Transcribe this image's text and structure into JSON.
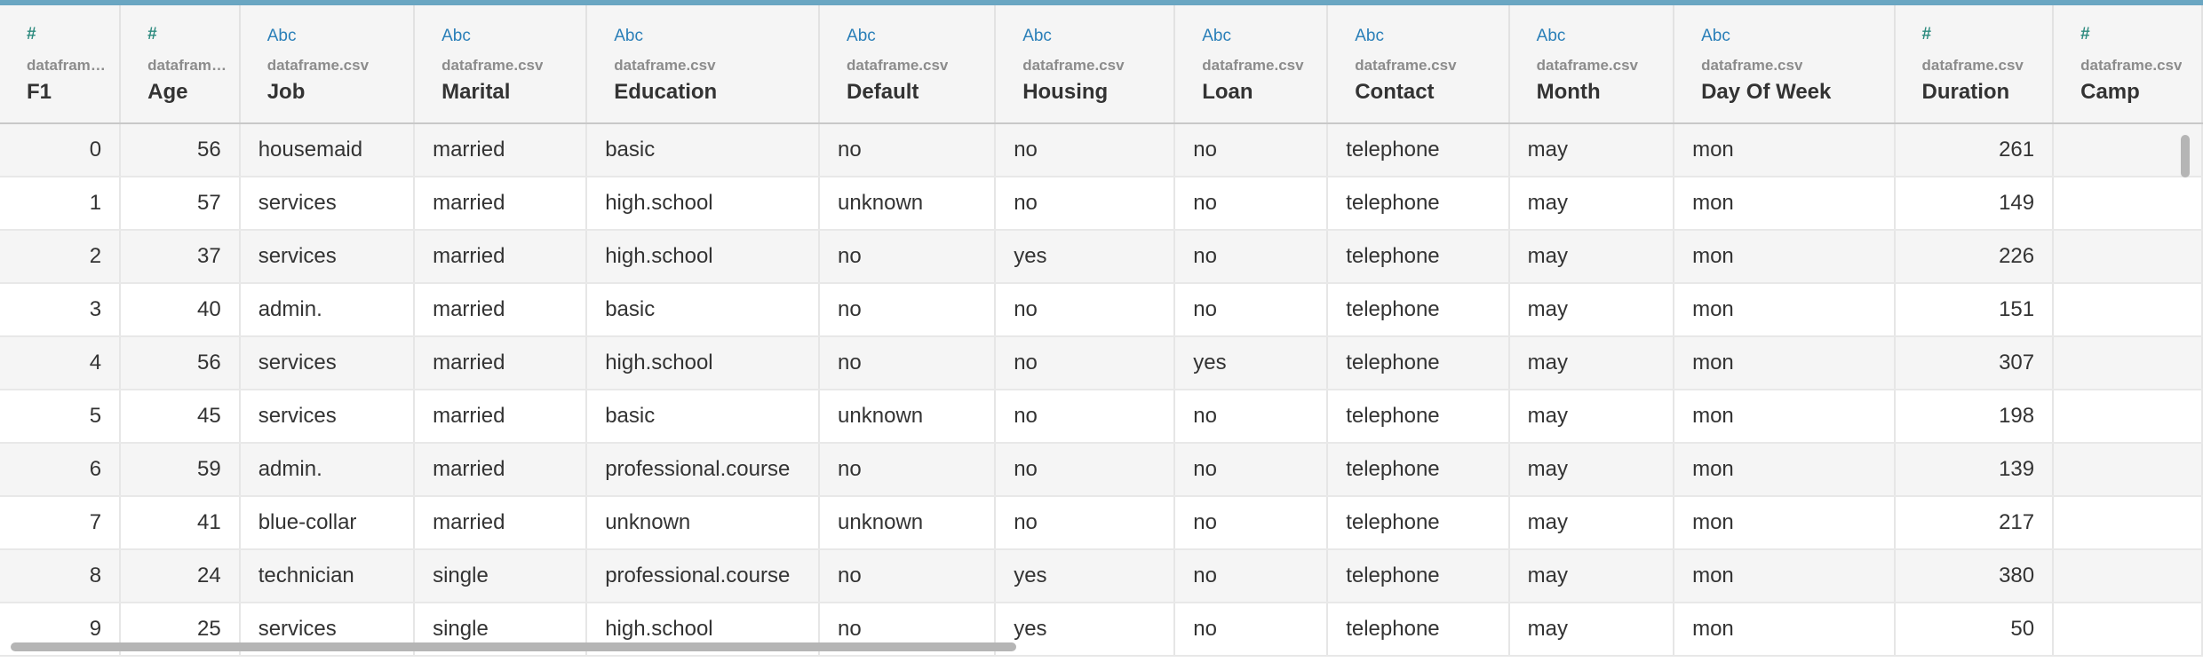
{
  "columns": [
    {
      "type_icon": "#",
      "source": "dataframe....",
      "name": "F1"
    },
    {
      "type_icon": "#",
      "source": "dataframe....",
      "name": "Age"
    },
    {
      "type_icon": "Abc",
      "source": "dataframe.csv",
      "name": "Job"
    },
    {
      "type_icon": "Abc",
      "source": "dataframe.csv",
      "name": "Marital"
    },
    {
      "type_icon": "Abc",
      "source": "dataframe.csv",
      "name": "Education"
    },
    {
      "type_icon": "Abc",
      "source": "dataframe.csv",
      "name": "Default"
    },
    {
      "type_icon": "Abc",
      "source": "dataframe.csv",
      "name": "Housing"
    },
    {
      "type_icon": "Abc",
      "source": "dataframe.csv",
      "name": "Loan"
    },
    {
      "type_icon": "Abc",
      "source": "dataframe.csv",
      "name": "Contact"
    },
    {
      "type_icon": "Abc",
      "source": "dataframe.csv",
      "name": "Month"
    },
    {
      "type_icon": "Abc",
      "source": "dataframe.csv",
      "name": "Day Of Week"
    },
    {
      "type_icon": "#",
      "source": "dataframe.csv",
      "name": "Duration"
    },
    {
      "type_icon": "#",
      "source": "dataframe.csv",
      "name": "Camp"
    }
  ],
  "rows": [
    [
      "0",
      "56",
      "housemaid",
      "married",
      "basic",
      "no",
      "no",
      "no",
      "telephone",
      "may",
      "mon",
      "261",
      ""
    ],
    [
      "1",
      "57",
      "services",
      "married",
      "high.school",
      "unknown",
      "no",
      "no",
      "telephone",
      "may",
      "mon",
      "149",
      ""
    ],
    [
      "2",
      "37",
      "services",
      "married",
      "high.school",
      "no",
      "yes",
      "no",
      "telephone",
      "may",
      "mon",
      "226",
      ""
    ],
    [
      "3",
      "40",
      "admin.",
      "married",
      "basic",
      "no",
      "no",
      "no",
      "telephone",
      "may",
      "mon",
      "151",
      ""
    ],
    [
      "4",
      "56",
      "services",
      "married",
      "high.school",
      "no",
      "no",
      "yes",
      "telephone",
      "may",
      "mon",
      "307",
      ""
    ],
    [
      "5",
      "45",
      "services",
      "married",
      "basic",
      "unknown",
      "no",
      "no",
      "telephone",
      "may",
      "mon",
      "198",
      ""
    ],
    [
      "6",
      "59",
      "admin.",
      "married",
      "professional.course",
      "no",
      "no",
      "no",
      "telephone",
      "may",
      "mon",
      "139",
      ""
    ],
    [
      "7",
      "41",
      "blue-collar",
      "married",
      "unknown",
      "unknown",
      "no",
      "no",
      "telephone",
      "may",
      "mon",
      "217",
      ""
    ],
    [
      "8",
      "24",
      "technician",
      "single",
      "professional.course",
      "no",
      "yes",
      "no",
      "telephone",
      "may",
      "mon",
      "380",
      ""
    ],
    [
      "9",
      "25",
      "services",
      "single",
      "high.school",
      "no",
      "yes",
      "no",
      "telephone",
      "may",
      "mon",
      "50",
      ""
    ]
  ],
  "numeric_columns": [
    0,
    1,
    11,
    12
  ],
  "colors": {
    "header_accent": "#6aa6c2",
    "numeric_icon": "#2e8b7f",
    "text_icon": "#2a7fb8"
  }
}
